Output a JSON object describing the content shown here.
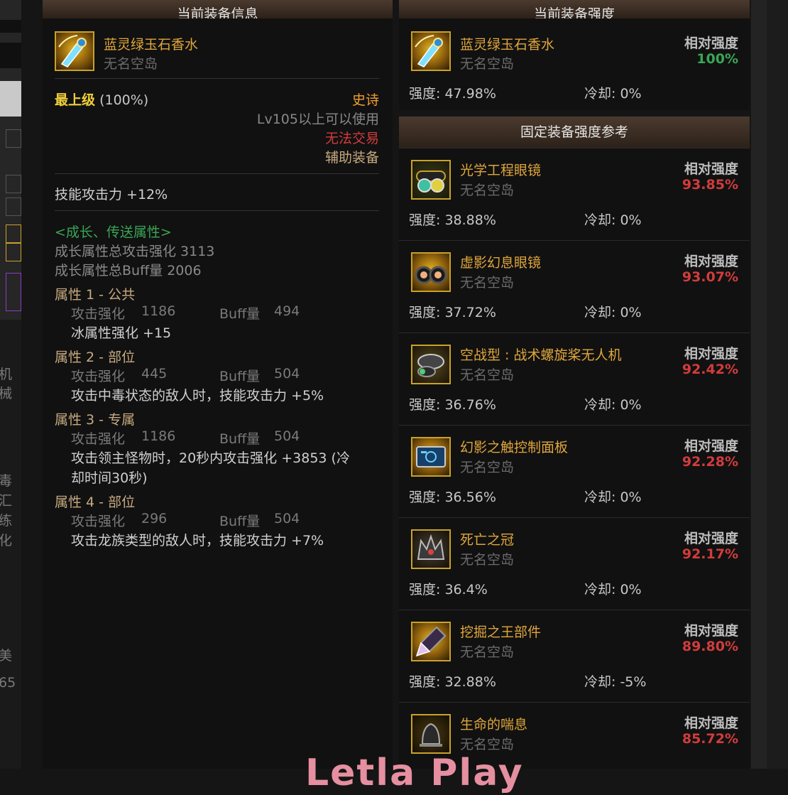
{
  "colors": {
    "accent_gold": "#e0a63c",
    "green": "#3aa655",
    "red": "#d23c3c",
    "title_bar": "#3a2c22"
  },
  "bg_fragments": {
    "f1": "机械",
    "f2": "毒",
    "f3": "汇",
    "f4": "练",
    "f5": "化",
    "f6": "美",
    "f7": "65"
  },
  "left_panel": {
    "title": "当前装备信息",
    "item": {
      "name": "蓝灵绿玉石香水",
      "server": "无名空岛",
      "icon": "perfume-icon"
    },
    "grade_label": "最上级",
    "grade_pct": "(100%)",
    "rarity": "史诗",
    "level_req": "Lv105以上可以使用",
    "trade": "无法交易",
    "slot": "辅助装备",
    "stat": "技能攻击力 +12%",
    "growth_header": "<成长、传送属性>",
    "growth_total_atk": "成长属性总攻击强化 3113",
    "growth_total_buff": "成长属性总Buff量 2006",
    "attributes": [
      {
        "title": "属性 1 - 公共",
        "atk_label": "攻击强化",
        "atk": "1186",
        "buff_label": "Buff量",
        "buff": "494",
        "effect": "冰属性强化 +15"
      },
      {
        "title": "属性 2 - 部位",
        "atk_label": "攻击强化",
        "atk": "445",
        "buff_label": "Buff量",
        "buff": "504",
        "effect": "攻击中毒状态的敌人时，技能攻击力 +5%"
      },
      {
        "title": "属性 3 - 专属",
        "atk_label": "攻击强化",
        "atk": "1186",
        "buff_label": "Buff量",
        "buff": "504",
        "effect_l1": "攻击领主怪物时，20秒内攻击强化 +3853 (冷",
        "effect_l2": "却时间30秒)"
      },
      {
        "title": "属性 4 - 部位",
        "atk_label": "攻击强化",
        "atk": "296",
        "buff_label": "Buff量",
        "buff": "504",
        "effect": "攻击龙族类型的敌人时，技能攻击力 +7%"
      }
    ]
  },
  "current_panel": {
    "title": "当前装备强度",
    "item": {
      "name": "蓝灵绿玉石香水",
      "server": "无名空岛",
      "icon": "perfume-icon"
    },
    "rel_label": "相对强度",
    "rel_value": "100%",
    "strength": "强度: 47.98%",
    "cooldown": "冷却: 0%"
  },
  "reference_panel": {
    "title": "固定装备强度参考",
    "items": [
      {
        "name": "光学工程眼镜",
        "server": "无名空岛",
        "rel_label": "相对强度",
        "rel_value": "93.85%",
        "strength": "强度: 38.88%",
        "cooldown": "冷却: 0%",
        "icon": "goggles-icon"
      },
      {
        "name": "虚影幻息眼镜",
        "server": "无名空岛",
        "rel_label": "相对强度",
        "rel_value": "93.07%",
        "strength": "强度: 37.72%",
        "cooldown": "冷却: 0%",
        "icon": "binoculars-icon"
      },
      {
        "name": "空战型 : 战术螺旋桨无人机",
        "server": "无名空岛",
        "rel_label": "相对强度",
        "rel_value": "92.42%",
        "strength": "强度: 36.76%",
        "cooldown": "冷却: 0%",
        "icon": "drone-icon"
      },
      {
        "name": "幻影之触控制面板",
        "server": "无名空岛",
        "rel_label": "相对强度",
        "rel_value": "92.28%",
        "strength": "强度: 36.56%",
        "cooldown": "冷却: 0%",
        "icon": "tablet-icon"
      },
      {
        "name": "死亡之冠",
        "server": "无名空岛",
        "rel_label": "相对强度",
        "rel_value": "92.17%",
        "strength": "强度: 36.4%",
        "cooldown": "冷却: 0%",
        "icon": "crown-icon"
      },
      {
        "name": "挖掘之王部件",
        "server": "无名空岛",
        "rel_label": "相对强度",
        "rel_value": "89.80%",
        "strength": "强度: 32.88%",
        "cooldown": "冷却: -5%",
        "icon": "drill-icon"
      },
      {
        "name": "生命的喘息",
        "server": "无名空岛",
        "rel_label": "相对强度",
        "rel_value": "85.72%",
        "strength": "",
        "cooldown": "",
        "icon": "bell-icon"
      }
    ]
  },
  "watermark": "Letla Play"
}
